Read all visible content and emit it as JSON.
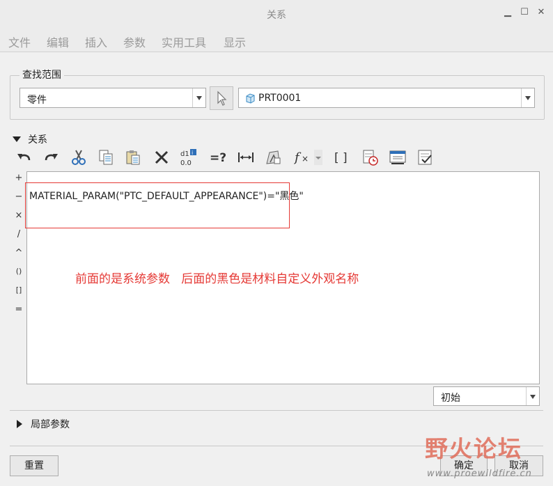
{
  "window": {
    "title": "关系",
    "minimize": "▁",
    "maximize": "☐",
    "close": "✕"
  },
  "menu": [
    "文件",
    "编辑",
    "插入",
    "参数",
    "实用工具",
    "显示"
  ],
  "search_scope": {
    "label": "查找范围",
    "type_value": "零件",
    "model_value": "PRT0001"
  },
  "relations": {
    "label": "关系",
    "toolbar_icons": [
      "undo-icon",
      "redo-icon",
      "cut-icon",
      "copy-icon",
      "paste-icon",
      "delete-icon",
      "toggle-display-icon",
      "evaluate-icon",
      "measure-icon",
      "sort-icon",
      "function-icon",
      "function-dropdown-icon",
      "brackets-icon",
      "verify-icon",
      "import-icon",
      "export-icon"
    ],
    "operators": [
      "+",
      "−",
      "×",
      "/",
      "^",
      "()",
      "[]",
      "="
    ],
    "code": "MATERIAL_PARAM(\"PTC_DEFAULT_APPEARANCE\")=\"黑色\"",
    "annotation": "前面的是系统参数   后面的黑色是材料自定义外观名称",
    "annotation_color": "#e53935",
    "filter_value": "初始"
  },
  "local_params": {
    "label": "局部参数"
  },
  "buttons": {
    "reset": "重置",
    "ok": "确定",
    "cancel": "取消"
  },
  "watermark": {
    "logo_text": "野火论坛",
    "url": "www.proewildfire.cn"
  }
}
